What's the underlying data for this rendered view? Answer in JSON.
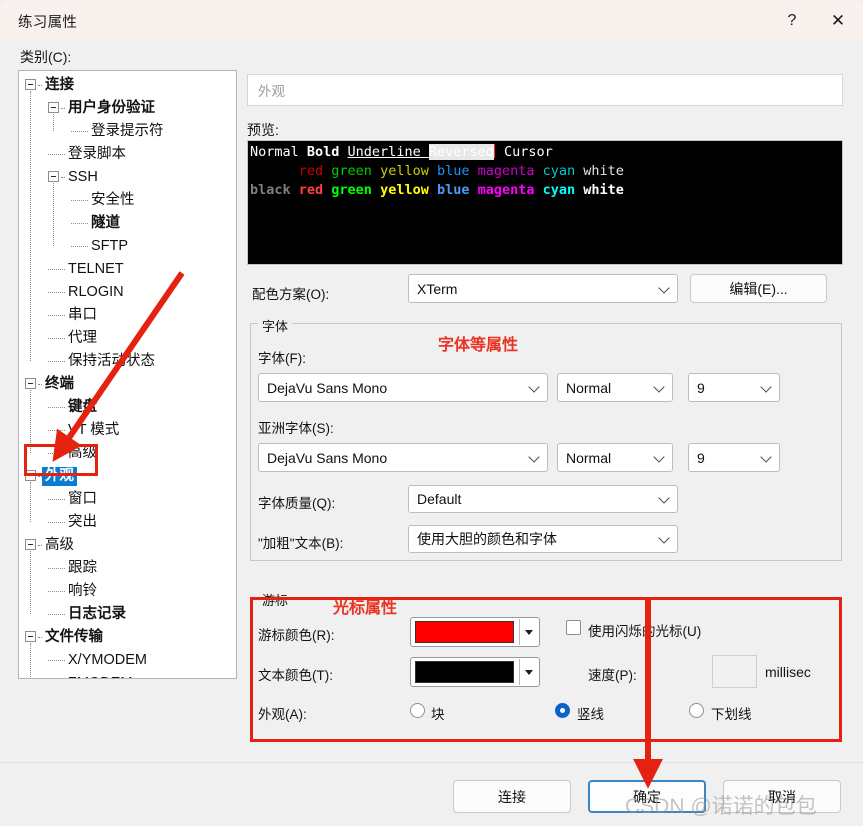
{
  "window": {
    "title": "练习属性",
    "help_label": "?",
    "close_label": "✕"
  },
  "category": {
    "label": "类别(C):",
    "tree": [
      {
        "label": "连接",
        "depth": 0,
        "bold": true,
        "expander": true,
        "selected": false
      },
      {
        "label": "用户身份验证",
        "depth": 1,
        "bold": true,
        "expander": true,
        "selected": false
      },
      {
        "label": "登录提示符",
        "depth": 2,
        "bold": false,
        "expander": false,
        "selected": false
      },
      {
        "label": "登录脚本",
        "depth": 1,
        "bold": false,
        "expander": false,
        "selected": false
      },
      {
        "label": "SSH",
        "depth": 1,
        "bold": false,
        "expander": true,
        "selected": false
      },
      {
        "label": "安全性",
        "depth": 2,
        "bold": false,
        "expander": false,
        "selected": false
      },
      {
        "label": "隧道",
        "depth": 2,
        "bold": true,
        "expander": false,
        "selected": false
      },
      {
        "label": "SFTP",
        "depth": 2,
        "bold": false,
        "expander": false,
        "selected": false
      },
      {
        "label": "TELNET",
        "depth": 1,
        "bold": false,
        "expander": false,
        "selected": false
      },
      {
        "label": "RLOGIN",
        "depth": 1,
        "bold": false,
        "expander": false,
        "selected": false
      },
      {
        "label": "串口",
        "depth": 1,
        "bold": false,
        "expander": false,
        "selected": false
      },
      {
        "label": "代理",
        "depth": 1,
        "bold": false,
        "expander": false,
        "selected": false
      },
      {
        "label": "保持活动状态",
        "depth": 1,
        "bold": false,
        "expander": false,
        "selected": false
      },
      {
        "label": "终端",
        "depth": 0,
        "bold": true,
        "expander": true,
        "selected": false
      },
      {
        "label": "键盘",
        "depth": 1,
        "bold": true,
        "expander": false,
        "selected": false
      },
      {
        "label": "VT 模式",
        "depth": 1,
        "bold": false,
        "expander": false,
        "selected": false
      },
      {
        "label": "高级",
        "depth": 1,
        "bold": false,
        "expander": false,
        "selected": false
      },
      {
        "label": "外观",
        "depth": 0,
        "bold": true,
        "expander": true,
        "selected": true
      },
      {
        "label": "窗口",
        "depth": 1,
        "bold": false,
        "expander": false,
        "selected": false
      },
      {
        "label": "突出",
        "depth": 1,
        "bold": false,
        "expander": false,
        "selected": false
      },
      {
        "label": "高级",
        "depth": 0,
        "bold": false,
        "expander": true,
        "selected": false
      },
      {
        "label": "跟踪",
        "depth": 1,
        "bold": false,
        "expander": false,
        "selected": false
      },
      {
        "label": "响铃",
        "depth": 1,
        "bold": false,
        "expander": false,
        "selected": false
      },
      {
        "label": "日志记录",
        "depth": 1,
        "bold": true,
        "expander": false,
        "selected": false
      },
      {
        "label": "文件传输",
        "depth": 0,
        "bold": true,
        "expander": true,
        "selected": false
      },
      {
        "label": "X/YMODEM",
        "depth": 1,
        "bold": false,
        "expander": false,
        "selected": false
      },
      {
        "label": "ZMODEM",
        "depth": 1,
        "bold": false,
        "expander": false,
        "selected": false
      }
    ]
  },
  "pane": {
    "header": "外观",
    "preview_label": "预览:"
  },
  "preview": {
    "line1": [
      {
        "text": "Normal ",
        "style": "normal"
      },
      {
        "text": "Bold ",
        "style": "bold"
      },
      {
        "text": "Underline ",
        "style": "underline"
      },
      {
        "text": "Reversed",
        "style": "reversed"
      },
      {
        "text": " Cursor",
        "style": "cursor"
      }
    ],
    "dim_colors": [
      "red",
      "green",
      "yellow",
      "blue",
      "magenta",
      "cyan",
      "white"
    ],
    "bright_colors": [
      "black",
      "red",
      "green",
      "yellow",
      "blue",
      "magenta",
      "cyan",
      "white"
    ],
    "palette": {
      "dim": {
        "red": "#cd0000",
        "green": "#00cd00",
        "yellow": "#cdcd00",
        "blue": "#1e90ff",
        "magenta": "#cd00cd",
        "cyan": "#00cdcd",
        "white": "#e5e5e5"
      },
      "bright": {
        "black": "#7f7f7f",
        "red": "#ff4040",
        "green": "#00ff00",
        "yellow": "#ffff00",
        "blue": "#4d9aff",
        "magenta": "#ff00ff",
        "cyan": "#00ffff",
        "white": "#ffffff"
      }
    },
    "background": "#000000",
    "cursor_color": "#ff2f2f"
  },
  "scheme": {
    "label": "配色方案(O):",
    "value": "XTerm",
    "edit_button": "编辑(E)..."
  },
  "font_group": {
    "title": "字体",
    "font_label": "字体(F):",
    "font_value": "DejaVu Sans Mono",
    "font_style": "Normal",
    "font_size": "9",
    "asian_label": "亚洲字体(S):",
    "asian_value": "DejaVu Sans Mono",
    "asian_style": "Normal",
    "asian_size": "9",
    "quality_label": "字体质量(Q):",
    "quality_value": "Default",
    "bold_label": "\"加粗\"文本(B):",
    "bold_value": "使用大胆的颜色和字体"
  },
  "cursor_group": {
    "title": "游标",
    "color_label": "游标颜色(R):",
    "color_value": "#FF0000",
    "text_color_label": "文本颜色(T):",
    "text_color_value": "#000000",
    "appearance_label": "外观(A):",
    "radios": [
      {
        "label": "块",
        "selected": false
      },
      {
        "label": "竖线",
        "selected": true
      },
      {
        "label": "下划线",
        "selected": false
      }
    ],
    "blink_label": "使用闪烁的光标(U)",
    "blink_checked": false,
    "speed_label": "速度(P):",
    "speed_value": "",
    "speed_unit": "millisec"
  },
  "footer": {
    "connect": "连接",
    "ok": "确定",
    "cancel": "取消"
  },
  "annotations": {
    "font_note": "字体等属性",
    "cursor_note": "光标属性",
    "accent": "#e4220f",
    "watermark": "CSDN @诺诺的包包"
  }
}
